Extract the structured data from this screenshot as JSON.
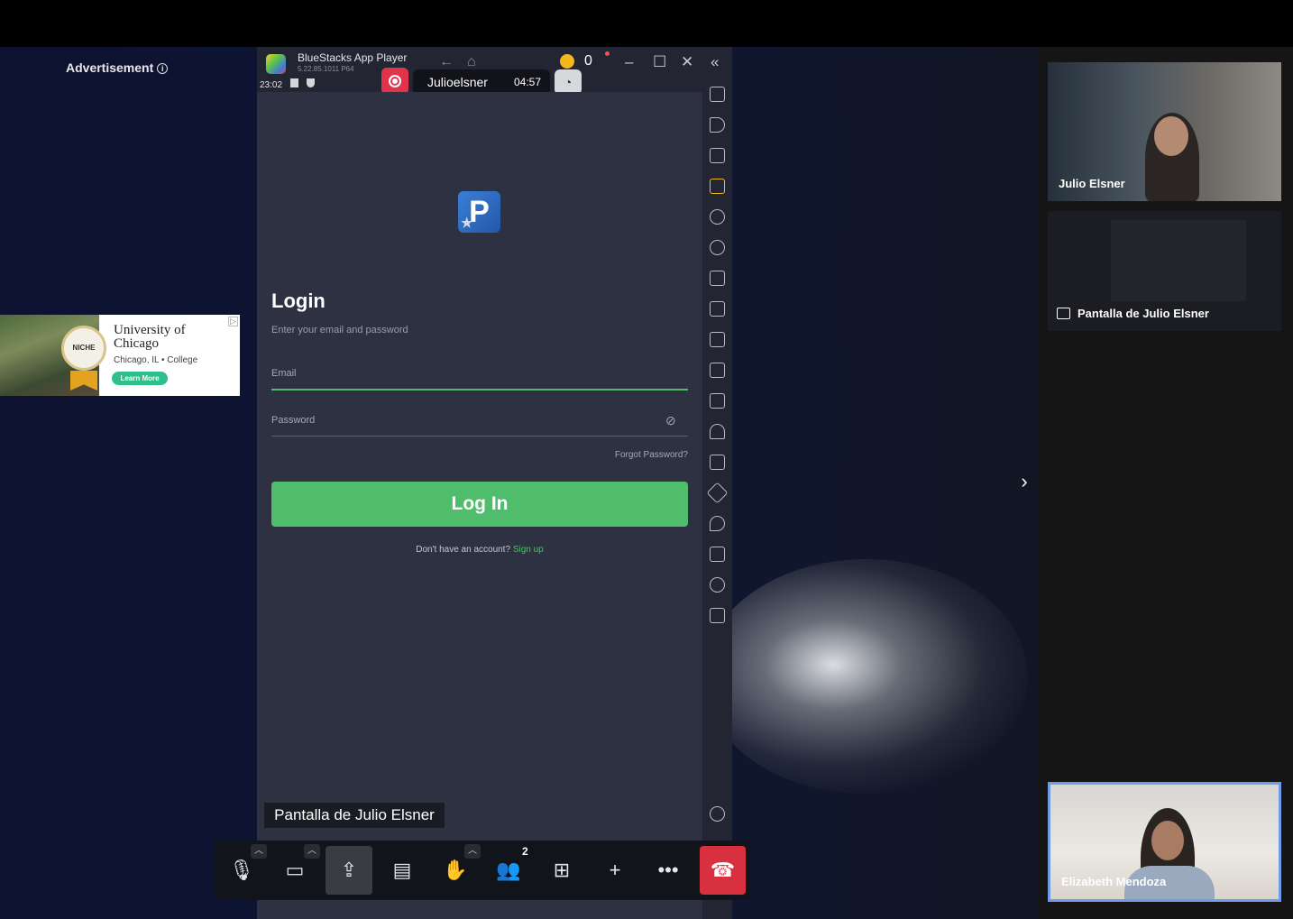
{
  "advertisement": {
    "label": "Advertisement",
    "info_icon": "info-icon",
    "title": "University of Chicago",
    "location": "Chicago, IL • College",
    "cta": "Learn More",
    "seal_text": "NICHE"
  },
  "bluestacks": {
    "app_name": "BlueStacks App Player",
    "version": "5.22.85.1011 P64",
    "clock": "23:02",
    "coins": "0",
    "recording": {
      "user": "Julioelsner",
      "elapsed": "04:57"
    }
  },
  "login_app": {
    "logo_letter": "P",
    "title": "Login",
    "subtitle": "Enter your email and password",
    "email_label": "Email",
    "password_label": "Password",
    "forgot_password": "Forgot Password?",
    "login_button": "Log In",
    "signup_prompt": "Don't have an account?",
    "signup_link": "Sign up"
  },
  "meeting": {
    "share_label": "Pantalla de Julio Elsner",
    "participants_count": "2",
    "participants": [
      {
        "name": "Julio Elsner"
      },
      {
        "name": "Pantalla de Julio Elsner"
      },
      {
        "name": "Elizabeth Mendoza"
      }
    ]
  },
  "colors": {
    "accent_green": "#4fbd6c",
    "hangup_red": "#d93040",
    "active_speaker_border": "#6f9ce8"
  }
}
